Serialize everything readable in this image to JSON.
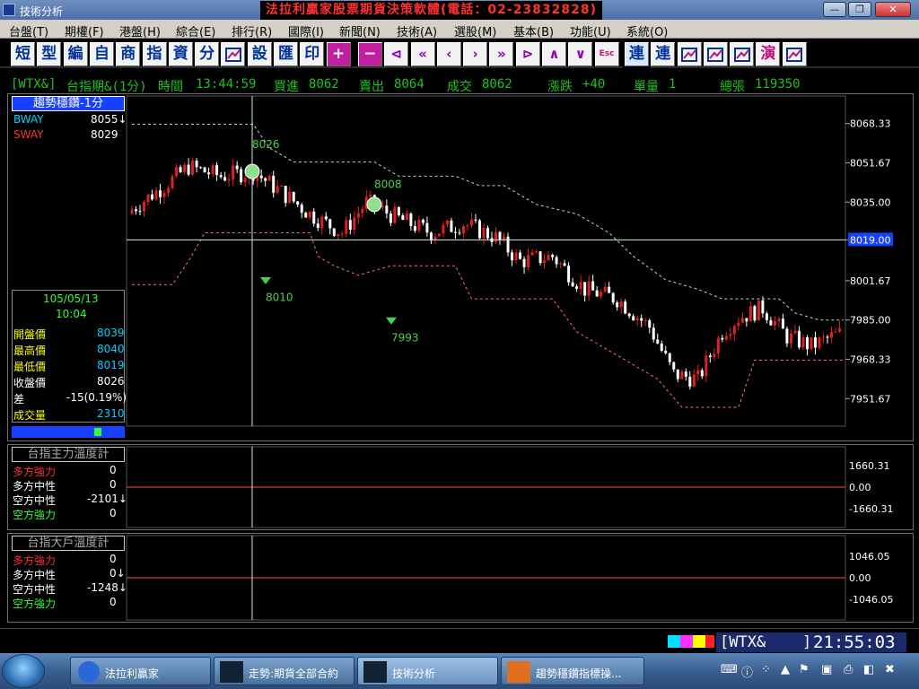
{
  "window": {
    "title": "技術分析",
    "brand": "法拉利贏家股票期貨決策軟體(電話：02-23832828)",
    "controls": {
      "minimize": "—",
      "restore": "❐",
      "close": "✕"
    }
  },
  "menu": [
    {
      "label": "台盤(T)"
    },
    {
      "label": "期權(F)"
    },
    {
      "label": "港盤(H)"
    },
    {
      "label": "綜合(E)"
    },
    {
      "label": "排行(R)"
    },
    {
      "label": "國際(I)"
    },
    {
      "label": "新聞(N)"
    },
    {
      "label": "技術(A)"
    },
    {
      "label": "選股(M)"
    },
    {
      "label": "基本(B)"
    },
    {
      "label": "功能(U)"
    },
    {
      "label": "系統(O)"
    }
  ],
  "toolbar": [
    {
      "label": "短",
      "icon": "short-char"
    },
    {
      "label": "型",
      "icon": "type-char"
    },
    {
      "label": "編",
      "icon": "edit-char"
    },
    {
      "label": "自",
      "icon": "self-char"
    },
    {
      "label": "商",
      "icon": "commodity-char"
    },
    {
      "label": "指",
      "icon": "indicator-char"
    },
    {
      "label": "資",
      "icon": "data-char"
    },
    {
      "label": "分",
      "icon": "minute-char"
    },
    {
      "label": "",
      "icon": "chart-icon"
    },
    {
      "label": "設",
      "icon": "settings-char"
    },
    {
      "label": "匯",
      "icon": "export-char"
    },
    {
      "label": "印",
      "icon": "print-char"
    },
    {
      "label": "+",
      "icon": "zoom-in-icon"
    },
    {
      "label": "−",
      "icon": "zoom-out-icon"
    },
    {
      "label": "⊲",
      "icon": "first-icon"
    },
    {
      "label": "«",
      "icon": "fast-back-icon"
    },
    {
      "label": "‹",
      "icon": "back-icon"
    },
    {
      "label": "›",
      "icon": "forward-icon"
    },
    {
      "label": "»",
      "icon": "fast-forward-icon"
    },
    {
      "label": "⊳",
      "icon": "last-icon"
    },
    {
      "label": "∧",
      "icon": "up-icon"
    },
    {
      "label": "∨",
      "icon": "down-icon"
    },
    {
      "label": "Esc",
      "icon": "escape-icon"
    },
    {
      "label": "連",
      "icon": "link-char"
    },
    {
      "label": "連",
      "icon": "link2-char"
    },
    {
      "label": "",
      "icon": "window-icon"
    },
    {
      "label": "",
      "icon": "lock-icon"
    },
    {
      "label": "",
      "icon": "tools-icon"
    },
    {
      "label": "演",
      "icon": "demo-char"
    },
    {
      "label": "",
      "icon": "pen-icon"
    }
  ],
  "quote": {
    "symbol": "[WTX&]",
    "name": "台指期&(1分)",
    "time_label": "時間",
    "time": "13:44:59",
    "bid_label": "買進",
    "bid": "8062",
    "ask_label": "賣出",
    "ask": "8064",
    "last_label": "成交",
    "last": "8062",
    "change_label": "漲跌",
    "change": "+40",
    "volume_label": "單量",
    "volume": "1",
    "total_label": "總張",
    "total": "119350"
  },
  "main_panel": {
    "title": "趨勢穩鑽-1分",
    "bway_label": "BWAY",
    "bway_value": "8055↓",
    "sway_label": "SWAY",
    "sway_value": "8029",
    "date": "105/05/13",
    "time": "10:04",
    "open_label": "開盤價",
    "open": "8039",
    "high_label": "最高價",
    "high": "8040",
    "low_label": "最低價",
    "low": "8019",
    "close_label": "收盤價",
    "close": "8026",
    "diff_label": "差",
    "diff": "-15(0.19%)",
    "vol_label": "成交量",
    "vol": "2310",
    "y_ticks": [
      "8068.33",
      "8051.67",
      "8035.00",
      "8019.00",
      "8001.67",
      "7985.00",
      "7968.33",
      "7951.67"
    ],
    "crosshair_price": "8019.00",
    "annotations": [
      "8026",
      "8008",
      "8010",
      "7993"
    ]
  },
  "temp_panel1": {
    "title": "台指主力溫度計",
    "rows": [
      {
        "label": "多方強力",
        "value": "0",
        "color": "#ff3030"
      },
      {
        "label": "多方中性",
        "value": "0",
        "color": "#ffffff"
      },
      {
        "label": "空方中性",
        "value": "-2101↓",
        "color": "#ffffff"
      },
      {
        "label": "空方強力",
        "value": "0",
        "color": "#30ff30"
      }
    ],
    "y_ticks": [
      "1660.31",
      "0.00",
      "-1660.31"
    ]
  },
  "temp_panel2": {
    "title": "台指大戶溫度計",
    "rows": [
      {
        "label": "多方強力",
        "value": "0",
        "color": "#ff3030"
      },
      {
        "label": "多方中性",
        "value": "0↓",
        "color": "#ffffff"
      },
      {
        "label": "空方中性",
        "value": "-1248↓",
        "color": "#ffffff"
      },
      {
        "label": "空方強力",
        "value": "0",
        "color": "#30ff30"
      }
    ],
    "y_ticks": [
      "1046.05",
      "0.00",
      "-1046.05"
    ]
  },
  "status": {
    "symbol": "[WTX&",
    "bracket": "]",
    "clock": "21:55:03"
  },
  "taskbar": {
    "items": [
      {
        "label": "法拉利贏家"
      },
      {
        "label": "走勢:期貨全部合約"
      },
      {
        "label": "技術分析"
      },
      {
        "label": "趨勢穩鑽指標操..."
      }
    ]
  },
  "colors": {
    "up": "#e02020",
    "down": "#ffffff",
    "up_bar": "#ffaaaa",
    "down_bar": "#7dff7d",
    "resistance": "#a0e0e0",
    "support": "#ff7070",
    "axis_text": "#ffffff",
    "highlight": "#1840ff"
  }
}
